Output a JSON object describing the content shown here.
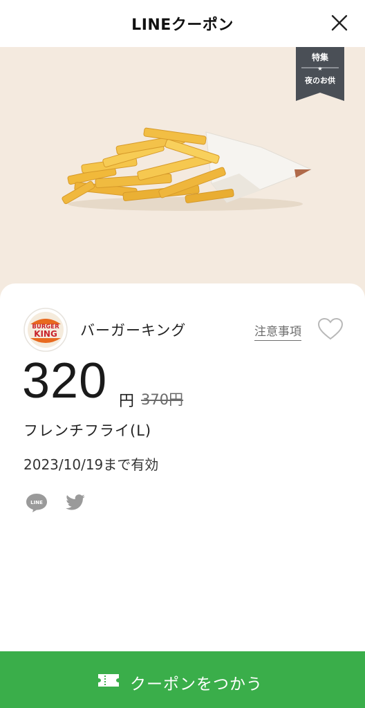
{
  "header": {
    "title": "LINEクーポン"
  },
  "hero": {
    "tag_top": "特集",
    "tag_bottom": "夜のお供"
  },
  "brand": {
    "logo_text_top": "BURGER",
    "logo_text_bottom": "KING",
    "name": "バーガーキング"
  },
  "links": {
    "notes": "注意事項"
  },
  "offer": {
    "price": "320",
    "currency": "円",
    "original_price": "370円",
    "product": "フレンチフライ(L)",
    "validity": "2023/10/19まで有効"
  },
  "share": {
    "line_label": "LINE"
  },
  "cta": {
    "label": "クーポンをつかう"
  },
  "colors": {
    "cta_green": "#3aae4a",
    "hero_bg": "#f4eadf",
    "tag_bg": "#4a4f56"
  }
}
